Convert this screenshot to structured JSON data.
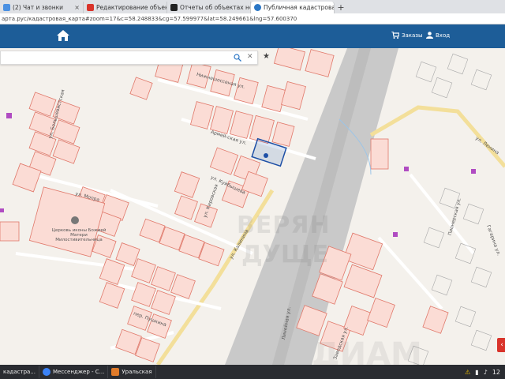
{
  "browser": {
    "tabs": [
      {
        "label": "(2) Чат и звонки",
        "color": "#4a90e2"
      },
      {
        "label": "Редактирование объекта Ав",
        "color": "#d9342b"
      },
      {
        "label": "Отчеты об объектах недви",
        "color": "#222222"
      },
      {
        "label": "Публичная кадастровая ка",
        "color": "#2b76c5"
      }
    ],
    "new_tab": "+",
    "address": "арта.рус/кадастровая_карта#zoom=17&c=58.248833&cg=57.599977&lat=58.249661&lng=57.600370"
  },
  "header": {
    "home_icon": "home-icon",
    "orders_label": "Заказы",
    "login_label": "Вход",
    "bg": "#1d5d98"
  },
  "search": {
    "value": "",
    "placeholder": ""
  },
  "map_labels": {
    "street1": "Нижнешоссеная ул.",
    "street2": "Армей-ская ул.",
    "street3": "ул. Большевистская",
    "street4": "ул. Кировская",
    "street5": "ул. Куйбышева",
    "street6": "ул. Калинина",
    "street7": "ул. Ленина",
    "street8": "ул. Мопра",
    "street9": "Заводская ул.",
    "street10": "Линейная ул.",
    "street11": "Пионерская ул.",
    "street12": "Гагарина ул.",
    "street13": "пер. Пушкина",
    "church": "Церковь иконы Божией Матери Милостивительница",
    "wm1": "ВЕРЯН",
    "wm2": "ДУЩЕ",
    "wm3": "ДИАМ"
  },
  "taskbar": {
    "items": [
      {
        "label": "кадастра...",
        "color": "#2b76c5"
      },
      {
        "label": "Мессенджер - С...",
        "color": "#3b82f6"
      },
      {
        "label": "Уральская",
        "color": "#e07b2a"
      }
    ],
    "clock": "12"
  }
}
